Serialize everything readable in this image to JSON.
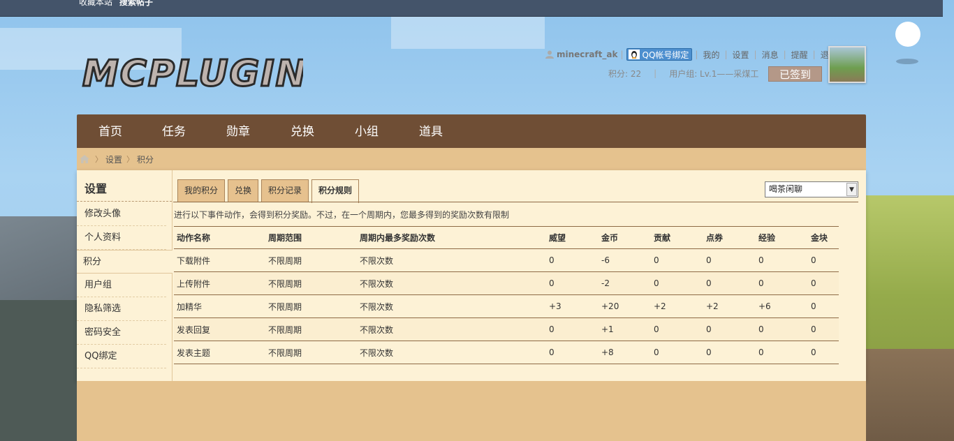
{
  "topbar": {
    "link1": "收藏本站",
    "link2": "搜索帖子"
  },
  "logo": {
    "text": "MCPLUGIN"
  },
  "user": {
    "username": "minecraft_ak",
    "qq_bind": "QQ帐号绑定",
    "links": [
      "我的",
      "设置",
      "消息",
      "提醒",
      "退出"
    ],
    "credits": "积分: 22",
    "group": "用户组: Lv.1——采煤工",
    "signed": "已签到"
  },
  "nav": {
    "items": [
      "首页",
      "任务",
      "勋章",
      "兑换",
      "小组",
      "道具"
    ]
  },
  "breadcrumb": {
    "items": [
      "设置",
      "积分"
    ]
  },
  "sidebar": {
    "title": "设置",
    "items": [
      "修改头像",
      "个人资料",
      "积分",
      "用户组",
      "隐私筛选",
      "密码安全",
      "QQ绑定"
    ]
  },
  "tabs": [
    "我的积分",
    "兑换",
    "积分记录",
    "积分规则"
  ],
  "select": {
    "value": "喝茶闲聊"
  },
  "notice": "进行以下事件动作，会得到积分奖励。不过，在一个周期内，您最多得到的奖励次数有限制",
  "table": {
    "headers": [
      "动作名称",
      "周期范围",
      "周期内最多奖励次数",
      "威望",
      "金币",
      "贡献",
      "点券",
      "经验",
      "金块"
    ],
    "rows": [
      [
        "下载附件",
        "不限周期",
        "不限次数",
        "0",
        "-6",
        "0",
        "0",
        "0",
        "0"
      ],
      [
        "上传附件",
        "不限周期",
        "不限次数",
        "0",
        "-2",
        "0",
        "0",
        "0",
        "0"
      ],
      [
        "加精华",
        "不限周期",
        "不限次数",
        "+3",
        "+20",
        "+2",
        "+2",
        "+6",
        "0"
      ],
      [
        "发表回复",
        "不限周期",
        "不限次数",
        "0",
        "+1",
        "0",
        "0",
        "0",
        "0"
      ],
      [
        "发表主题",
        "不限周期",
        "不限次数",
        "0",
        "+8",
        "0",
        "0",
        "0",
        "0"
      ]
    ]
  },
  "colors": {
    "nav_bg": "#6f4e35",
    "panel_bg": "#fdf2d6",
    "tab_bg": "#e6c18e",
    "breadcrumb_bg": "#e5c28e",
    "topbar_bg": "#44546a",
    "signed_btn": "#b49888",
    "qq_btn": "#4d8fcf"
  }
}
